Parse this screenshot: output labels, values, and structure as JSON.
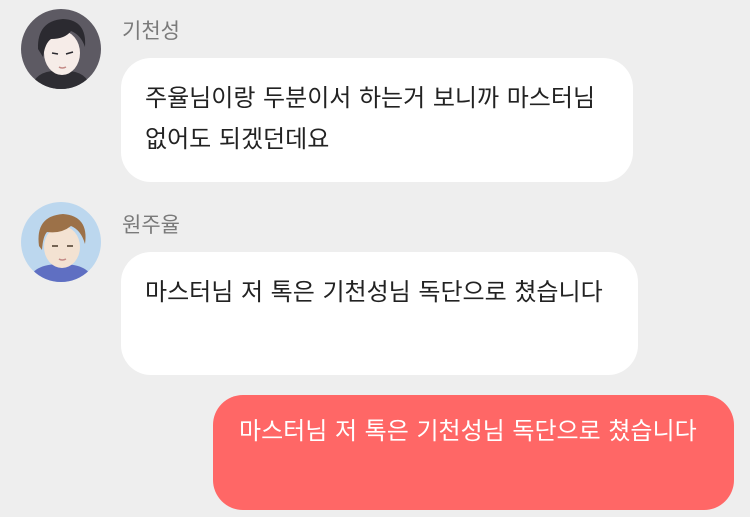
{
  "messages": [
    {
      "sender": "기천성",
      "text": "주율님이랑 두분이서 하는거 보니까 마스터님 없어도 되겠던데요",
      "direction": "incoming",
      "avatar": "dark-haired-man-avatar"
    },
    {
      "sender": "원주율",
      "text": "마스터님 저 톡은 기천성님 독단으로 쳤습니다",
      "direction": "incoming",
      "avatar": "brown-haired-man-avatar"
    },
    {
      "text": "마스터님 저 톡은 기천성님 독단으로 쳤습니다",
      "direction": "outgoing"
    }
  ],
  "colors": {
    "background": "#eeeeee",
    "incoming_bubble": "#ffffff",
    "outgoing_bubble": "#ff6766",
    "sender_name": "#7a7a7a"
  }
}
